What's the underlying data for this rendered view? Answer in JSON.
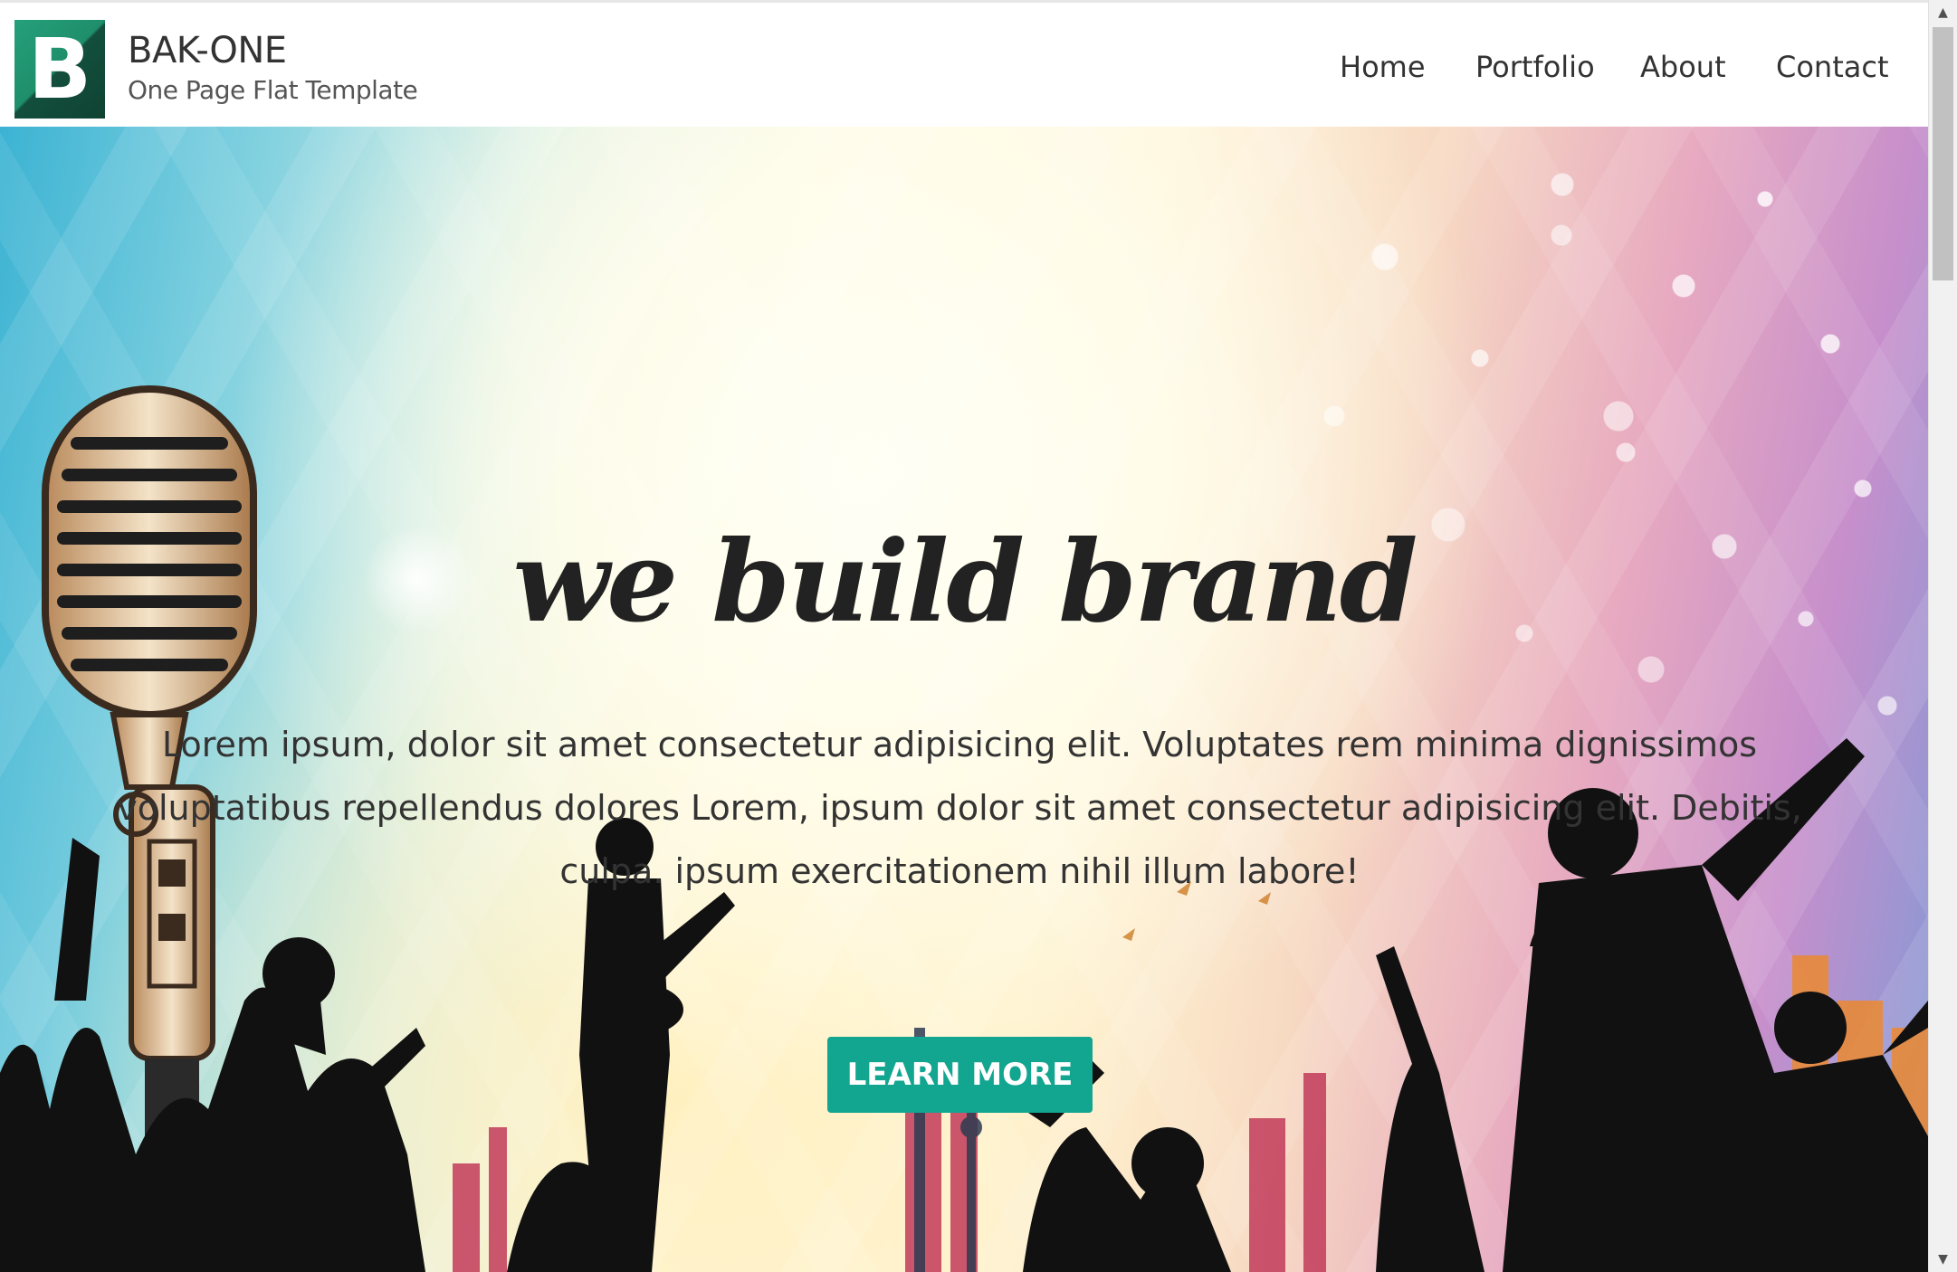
{
  "brand": {
    "logo_letter": "B",
    "title": "BAK-ONE",
    "subtitle": "One Page Flat Template"
  },
  "nav": {
    "items": [
      {
        "label": "Home"
      },
      {
        "label": "Portfolio"
      },
      {
        "label": "About"
      },
      {
        "label": "Contact"
      }
    ]
  },
  "hero": {
    "title": "we build brand",
    "text": "Lorem ipsum, dolor sit amet consectetur adipisicing elit. Voluptates rem minima dignissimos voluptatibus repellendus dolores Lorem, ipsum dolor sit amet consectetur adipisicing elit. Debitis, culpa. ipsum exercitationem nihil illum labore!",
    "button_label": "LEARN MORE"
  },
  "scrollbar": {
    "up_icon": "▲",
    "down_icon": "▼"
  },
  "colors": {
    "accent": "#12a590",
    "logo_green": "#1a7f5e",
    "text": "#333333"
  }
}
